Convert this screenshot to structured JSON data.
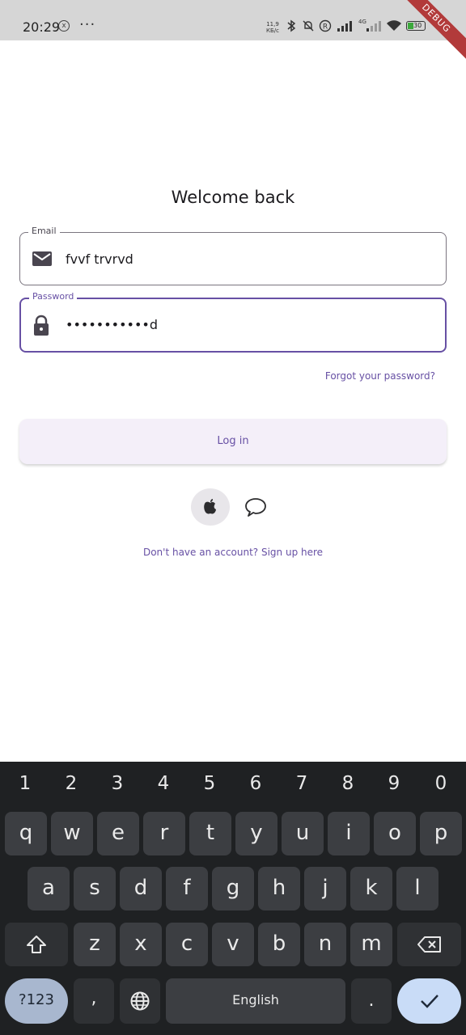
{
  "status_bar": {
    "time": "20:29",
    "dots": "···",
    "net_speed_value": "11,9",
    "net_speed_unit": "КБ/с",
    "signal_label": "4G",
    "battery": "30",
    "debug_banner": "DEBUG"
  },
  "screen": {
    "title": "Welcome back",
    "email": {
      "label": "Email",
      "value": "fvvf trvrvd",
      "icon": "mail-icon"
    },
    "password": {
      "label": "Password",
      "value": "•••••••••••d",
      "icon": "lock-icon"
    },
    "forgot_link": "Forgot your password?",
    "login_button": "Log in",
    "social": [
      "apple-icon",
      "chat-bubble-icon"
    ],
    "signup_link": "Don't have an account? Sign up here",
    "accent_color": "#6750a4"
  },
  "keyboard": {
    "numbers": [
      "1",
      "2",
      "3",
      "4",
      "5",
      "6",
      "7",
      "8",
      "9",
      "0"
    ],
    "row1": [
      "q",
      "w",
      "e",
      "r",
      "t",
      "y",
      "u",
      "i",
      "o",
      "p"
    ],
    "row2": [
      "a",
      "s",
      "d",
      "f",
      "g",
      "h",
      "j",
      "k",
      "l"
    ],
    "row3": [
      "z",
      "x",
      "c",
      "v",
      "b",
      "n",
      "m"
    ],
    "symbols_key": "?123",
    "comma_key": ",",
    "space_label": "English",
    "period_key": "."
  }
}
